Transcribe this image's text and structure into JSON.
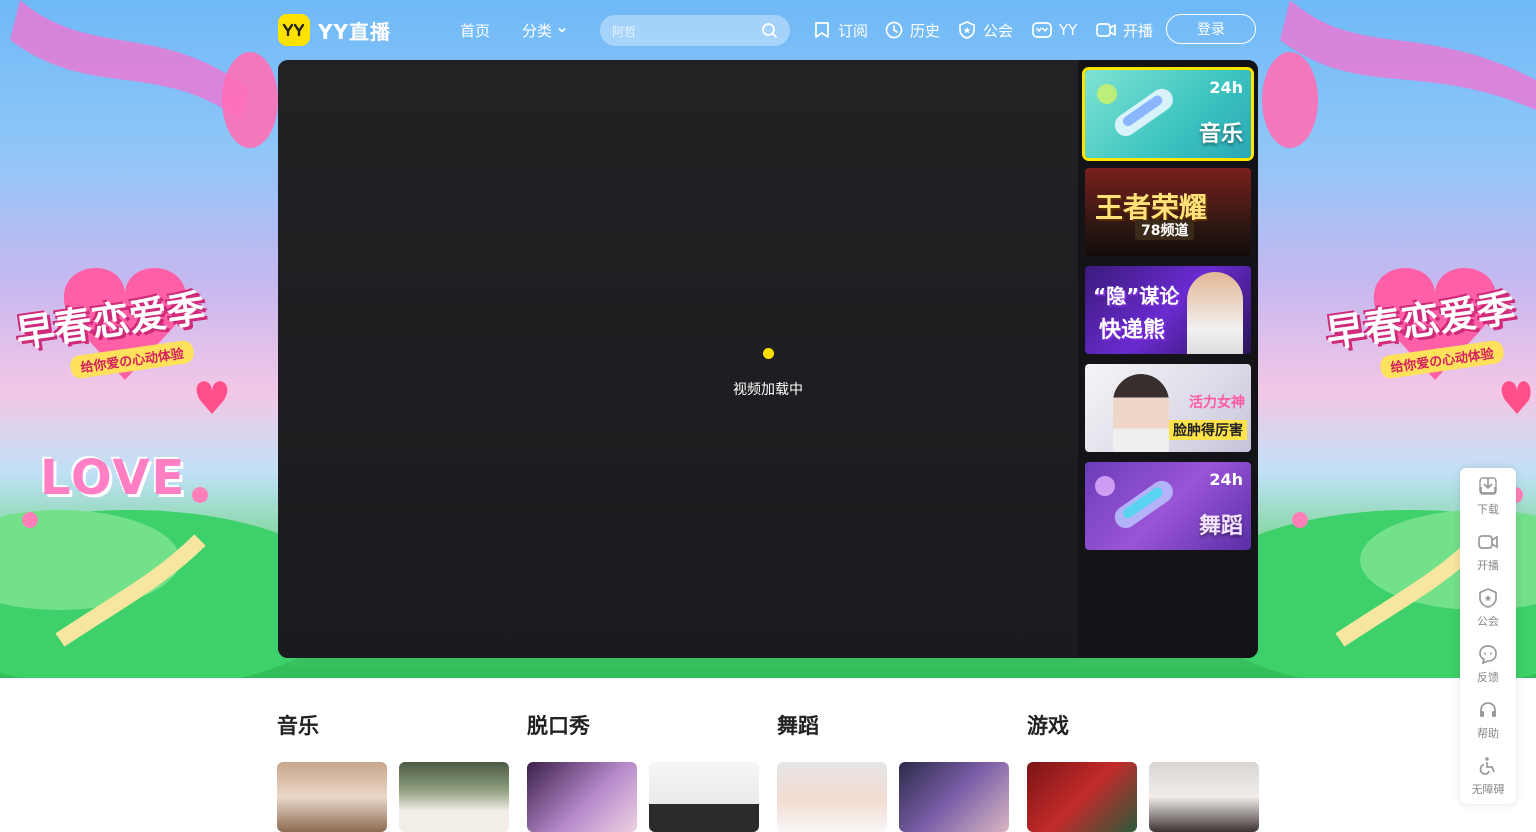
{
  "header": {
    "logo_text": "YY直播",
    "nav": [
      {
        "label": "首页"
      },
      {
        "label": "分类"
      }
    ],
    "search_placeholder": "阿哲",
    "actions": [
      {
        "label": "订阅",
        "icon": "bookmark-icon"
      },
      {
        "label": "历史",
        "icon": "clock-icon"
      },
      {
        "label": "公会",
        "icon": "shield-icon"
      },
      {
        "label": "YY",
        "icon": "yy-icon"
      },
      {
        "label": "开播",
        "icon": "camera-icon"
      }
    ],
    "login_label": "登录"
  },
  "player": {
    "loading_text": "视频加载中",
    "accent": "#ffdd00"
  },
  "side_channels": [
    {
      "title": "音乐",
      "badge": "24h",
      "active": true
    },
    {
      "title": "王者荣耀",
      "badge": "78频道",
      "active": false
    },
    {
      "title": "快递熊",
      "badge": "“隐”谋论",
      "active": false
    },
    {
      "title": "脸肿得厉害",
      "badge": "活力女神",
      "active": false
    },
    {
      "title": "舞蹈",
      "badge": "24h",
      "active": false
    }
  ],
  "float_bar": [
    {
      "label": "下载",
      "icon": "download-icon"
    },
    {
      "label": "开播",
      "icon": "camera-icon"
    },
    {
      "label": "公会",
      "icon": "shield-icon"
    },
    {
      "label": "反馈",
      "icon": "feedback-icon"
    },
    {
      "label": "帮助",
      "icon": "headset-icon"
    },
    {
      "label": "无障碍",
      "icon": "accessibility-icon"
    }
  ],
  "sections": [
    {
      "title": "音乐"
    },
    {
      "title": "脱口秀"
    },
    {
      "title": "舞蹈"
    },
    {
      "title": "游戏"
    }
  ],
  "hero_banner": {
    "left_title": "早春恋爱季",
    "left_sub": "给你爱の心动体验",
    "right_title": "早春恋爱季",
    "right_sub": "给你爱の心动体验",
    "love_text": "LOVE"
  }
}
